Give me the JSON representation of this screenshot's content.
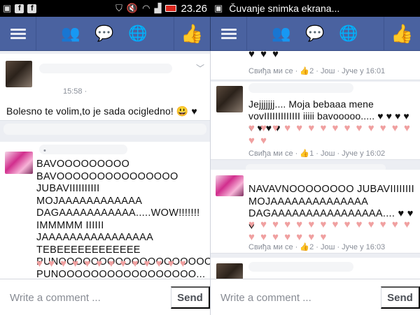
{
  "status_bar": {
    "left_icons": [
      "image-icon",
      "facebook-icon",
      "facebook-icon"
    ],
    "clock": "23.26",
    "notification": "Čuvanje snimka ekrana..."
  },
  "nav": {
    "menu_icon": "menu-icon",
    "friends_icon": "friends-icon",
    "messages_icon": "messages-icon",
    "globe_icon": "globe-icon",
    "like_icon": "thumbs-up-icon",
    "bar_color": "#4a62a0"
  },
  "left_panel": {
    "comments": [
      {
        "time": "15:58 ·",
        "text": "Bolesno te volim,to je sada ocigledno! 😃 ♥"
      },
      {
        "name": "•",
        "lines": [
          "BAVOOOOOOOOO",
          "BAVOOOOOOOOOOOOOOO JUBAVIIIIIIIIII",
          "MOJAAAAAAAAAAAA",
          "DAGAAAAAAAAAAA.....WOW!!!!!!!",
          "IMMMMM IIIIII JAAAAAAAAAAAAAAAA",
          "TEBEEEEEEEEEEEE",
          "PUNOOOOOOOOOOOOOOOOOOO",
          "PUNOOOOOOOOOOOOOOOOO... ♥ ♥"
        ],
        "hearts": "♥ ♥ ♥ ♥ ♥ ♥ ♥ ♥ ♥ ♥ ♥ ♥ ♥"
      }
    ]
  },
  "right_panel": {
    "top_hearts": "♥ ♥ ♥",
    "comments": [
      {
        "meta": "Свиђа ми се · 👍2 · Још · Јуче у 16:01"
      },
      {
        "name": "•",
        "text": "Jejjjjjjj.... Moja bebaaa mene vovIIIIIIIIIIIII iiiii bavooooo..... ♥ ♥ ♥ ♥ ♥ ♥ ♥ ♥",
        "hearts": "♥ ♥ ♥ ♥ ♥ ♥ ♥ ♥ ♥ ♥ ♥ ♥ ♥ ♥ ♥ ♥",
        "meta": "Свиђа ми се · 👍1 · Још · Јуче у 16:02"
      },
      {
        "text": "NAVAVNOOOOOOOO JUBAVIIIIIIII MOJAAAAAAAAAAAAAA DAGAAAAAAAAAAAAAAAA.... ♥ ♥ ♥",
        "hearts": "♥ ♥ ♥ ♥ ♥ ♥ ♥ ♥ ♥ ♥ ♥ ♥ ♥ ♥ ♥ ♥ ♥ ♥ ♥ ♥ ♥",
        "meta": "Свиђа ми се · 👍2 · Још · Јуче у 16:03"
      }
    ]
  },
  "composer": {
    "placeholder": "Write a comment ...",
    "send_label": "Send"
  }
}
